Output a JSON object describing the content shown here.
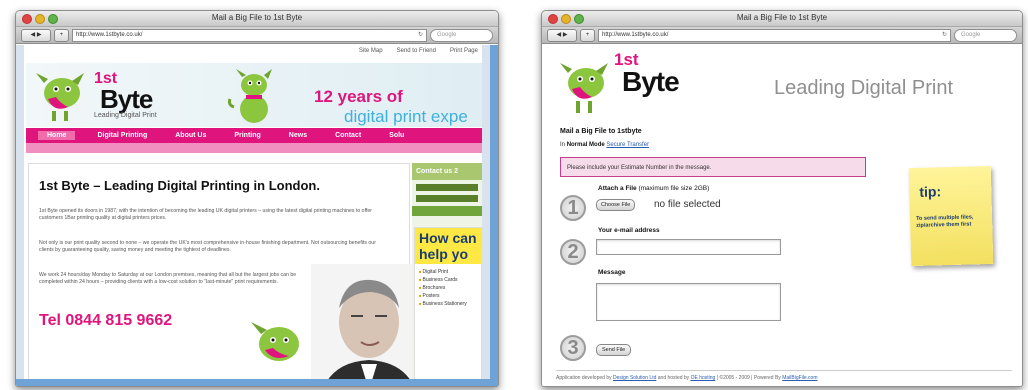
{
  "left_window": {
    "title": "Mail a Big File to 1st Byte",
    "url": "http://www.1stbyte.co.uk/",
    "search_placeholder": "Google",
    "util_links": [
      "Site Map",
      "Send to Friend",
      "Print Page"
    ],
    "logo": {
      "st": "1st",
      "byte": "Byte",
      "tagline": "Leading Digital Print"
    },
    "banner_line1": "12 years of",
    "banner_line2": "digital print expe",
    "nav": [
      "Home",
      "Digital Printing",
      "About Us",
      "Printing",
      "News",
      "Contact",
      "Solu"
    ],
    "heading": "1st Byte – Leading Digital Printing in London.",
    "paragraphs": [
      "1st Byte opened its doors in 1987, with the intention of becoming the leading UK digital printers – using the latest digital printing machines to offer customers 1Bar printing quality at digital printers prices.",
      "Not only is our print quality second to none – we operate the UK's most comprehensive in-house finishing department. Not outsourcing benefits our clients by guaranteeing quality, saving money and meeting the tightest of deadlines.",
      "We work 24 hours/day Monday to Saturday at our London premises, meaning that all but the largest jobs can be completed within 24 hours – providing clients with a low-cost solution to \"last-minute\" print requirements."
    ],
    "phone": "Tel 0844 815 9662",
    "side": {
      "contact_title": "Contact us 2",
      "help_title": "How can help yo",
      "services": [
        "Digital Print",
        "Business Cards",
        "Brochures",
        "Posters",
        "Business Stationery"
      ]
    }
  },
  "right_window": {
    "title": "Mail a Big File to 1st Byte",
    "url": "http://www.1stbyte.co.uk/",
    "search_placeholder": "Google",
    "logo": {
      "st": "1st",
      "byte": "Byte"
    },
    "headline": "Leading Digital Print",
    "form_title": "Mail a Big File to 1stbyte",
    "mode_prefix": "In",
    "mode_normal": "Normal Mode",
    "mode_secure": "Secure Transfer",
    "notice": "Please include your Estimate Number in the message.",
    "steps": [
      "1",
      "2",
      "3"
    ],
    "attach_label": "Attach a File",
    "attach_max": "(maximum file size 2GB)",
    "choose_file": "Choose File",
    "no_file": "no file selected",
    "email_label": "Your e-mail address",
    "email_value": "",
    "message_label": "Message",
    "message_value": "",
    "send_label": "Send File",
    "tip_title": "tip:",
    "tip_text": "To send multiple files, zip/archive them first",
    "footer_prefix": "Application developed by",
    "footer_dev": "Design Solution Ltd",
    "footer_mid": "and hosted by",
    "footer_host": "OE hosting",
    "footer_years": "| ©2005 - 2009 | Powered By",
    "footer_power": "MailBigFile.com"
  },
  "colors": {
    "brand_pink": "#e0147d",
    "brand_blue": "#3fb0dc",
    "dog_green": "#8cc63f",
    "tip_yellow": "#f7e55c"
  }
}
